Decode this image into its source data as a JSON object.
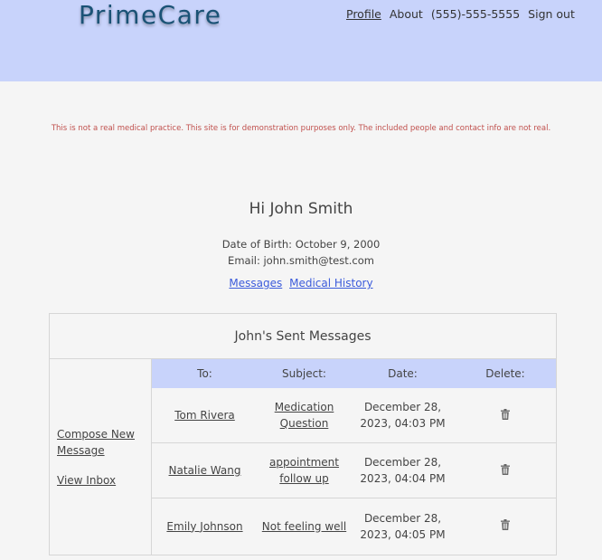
{
  "header": {
    "logo": "PrimeCare",
    "nav": [
      "Profile",
      "About",
      "(555)-555-5555",
      "Sign out"
    ]
  },
  "disclaimer": "This is not a real medical practice. This site is for demonstration purposes only. The included people and contact info are not real.",
  "profile": {
    "greeting": "Hi John Smith",
    "dob": "Date of Birth: October 9, 2000",
    "email": "Email: john.smith@test.com",
    "links": [
      "Messages",
      "Medical History"
    ]
  },
  "panel": {
    "title": "John's Sent Messages",
    "side": {
      "compose": "Compose New Message",
      "inbox": "View Inbox"
    },
    "columns": [
      "To:",
      "Subject:",
      "Date:",
      "Delete:"
    ],
    "rows": [
      {
        "to": "Tom Rivera",
        "subject": "Medication Question",
        "date": "December 28, 2023, 04:03 PM"
      },
      {
        "to": "Natalie Wang",
        "subject": "appointment follow up",
        "date": "December 28, 2023, 04:04 PM"
      },
      {
        "to": "Emily Johnson",
        "subject": "Not feeling well",
        "date": "December 28, 2023, 04:05 PM"
      }
    ]
  },
  "icons": {
    "delete": "trash-icon"
  },
  "colors": {
    "header_bg": "#c8d3fb",
    "logo": "#1a5275",
    "link": "#3b5bdb",
    "disclaimer": "#c0504d"
  }
}
